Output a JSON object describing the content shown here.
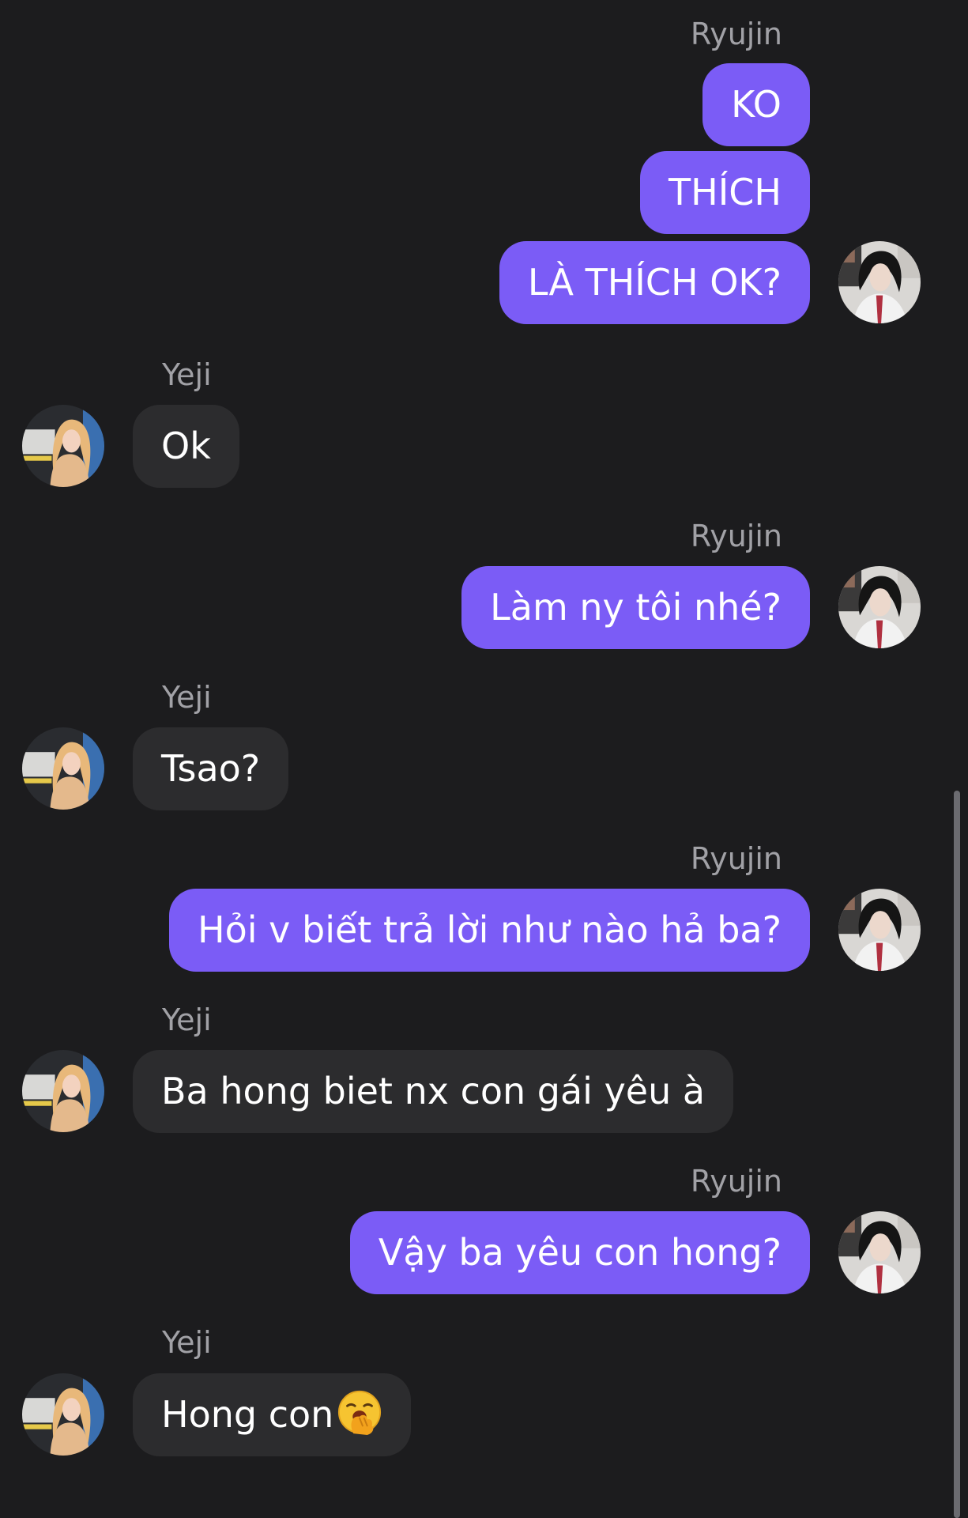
{
  "chat": {
    "messages": [
      {
        "sender": "Ryujin",
        "lines": [
          "KO",
          "THÍCH",
          "LÀ THÍCH OK?"
        ]
      },
      {
        "sender": "Yeji",
        "lines": [
          "Ok"
        ]
      },
      {
        "sender": "Ryujin",
        "lines": [
          "Làm ny tôi nhé?"
        ]
      },
      {
        "sender": "Yeji",
        "lines": [
          "Tsao?"
        ]
      },
      {
        "sender": "Ryujin",
        "lines": [
          "Hỏi v biết trả lời như nào hả ba?"
        ]
      },
      {
        "sender": "Yeji",
        "lines": [
          "Ba hong biet nx con gái yêu à"
        ]
      },
      {
        "sender": "Ryujin",
        "lines": [
          "Vậy ba yêu con hong?"
        ]
      },
      {
        "sender": "Yeji",
        "lines": [
          "Hong con"
        ]
      }
    ]
  },
  "icons": {
    "ryujin_avatar": "avatar-photo-dark-hair",
    "yeji_avatar": "avatar-photo-blonde-hair",
    "last_message_emoji": "face-with-hand-over-mouth-emoji"
  },
  "colors": {
    "background": "#1c1c1e",
    "outgoing_bubble": "#7b5cf6",
    "incoming_bubble": "#2c2c2e",
    "sender_name": "#a1a1a6",
    "text": "#ffffff"
  }
}
